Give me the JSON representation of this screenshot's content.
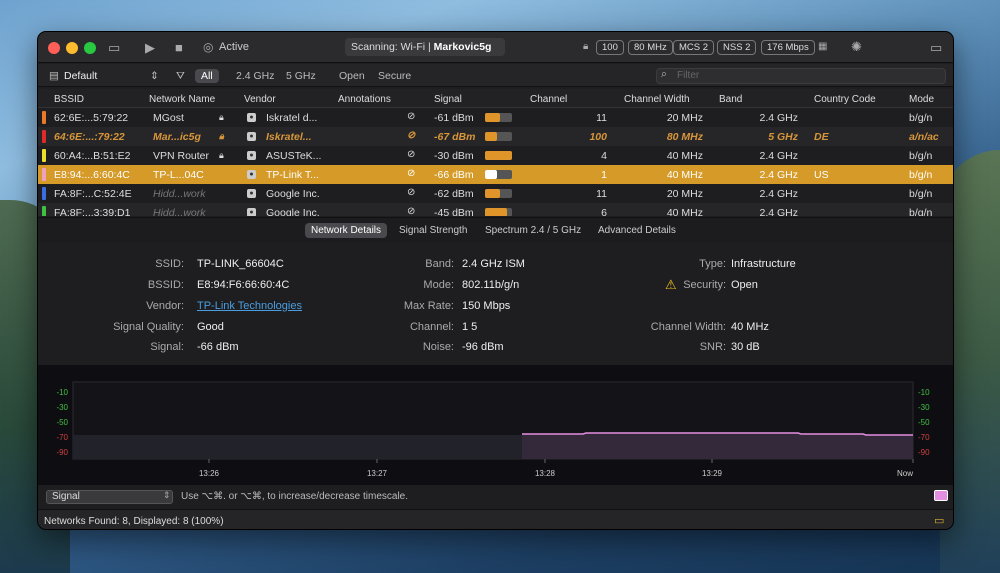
{
  "titlebar": {
    "active_label": "Active",
    "scan_prefix": "Scanning: Wi-Fi  |  ",
    "scan_network": "Markovic5g",
    "pills": [
      "100",
      "80 MHz",
      "MCS 2",
      "NSS 2",
      "176 Mbps"
    ]
  },
  "toolbar": {
    "profile": "Default",
    "filters": [
      "All",
      "2.4 GHz",
      "5 GHz",
      "Open",
      "Secure"
    ],
    "search_placeholder": "Filter"
  },
  "columns": [
    "BSSID",
    "Network Name",
    "Vendor",
    "Annotations",
    "Signal",
    "Channel",
    "Channel Width",
    "Band",
    "Country Code",
    "Mode"
  ],
  "rows": [
    {
      "tag": "#e8782a",
      "bssid": "62:6E:...5:79:22",
      "name": "MGost",
      "lock": true,
      "vendor": "Iskratel d...",
      "signal": "-61 dBm",
      "level": 0.55,
      "channel": "11",
      "width": "20 MHz",
      "band": "2.4 GHz",
      "country": "",
      "mode": "b/g/n"
    },
    {
      "tag": "#e02a2a",
      "bssid": "64:6E:...:79:22",
      "name": "Mar...ic5g",
      "lock": true,
      "vendor": "Iskratel...",
      "signal": "-67 dBm",
      "level": 0.45,
      "channel": "100",
      "width": "80 MHz",
      "band": "5 GHz",
      "country": "DE",
      "mode": "a/n/ac"
    },
    {
      "tag": "#e8e02a",
      "bssid": "60:A4:...B:51:E2",
      "name": "VPN Router",
      "lock": true,
      "vendor": "ASUSTeK...",
      "signal": "-30 dBm",
      "level": 1.0,
      "channel": "4",
      "width": "40 MHz",
      "band": "2.4 GHz",
      "country": "",
      "mode": "b/g/n"
    },
    {
      "tag": "#f0a0c0",
      "bssid": "E8:94:...6:60:4C",
      "name": "TP-L...04C",
      "lock": false,
      "vendor": "TP-Link T...",
      "signal": "-66 dBm",
      "level": 0.45,
      "channel": "1",
      "width": "40 MHz",
      "band": "2.4 GHz",
      "country": "US",
      "mode": "b/g/n"
    },
    {
      "tag": "#3a6ee0",
      "bssid": "FA:8F:...C:52:4E",
      "name": "Hidd...work",
      "lock": false,
      "vendor": "Google Inc.",
      "signal": "-62 dBm",
      "level": 0.55,
      "channel": "11",
      "width": "20 MHz",
      "band": "2.4 GHz",
      "country": "",
      "mode": "b/g/n"
    },
    {
      "tag": "#40c040",
      "bssid": "FA:8F:...3:39:D1",
      "name": "Hidd...work",
      "lock": false,
      "vendor": "Google Inc.",
      "signal": "-45 dBm",
      "level": 0.8,
      "channel": "6",
      "width": "40 MHz",
      "band": "2.4 GHz",
      "country": "",
      "mode": "b/g/n"
    }
  ],
  "tabs": [
    "Network Details",
    "Signal Strength",
    "Spectrum 2.4 / 5 GHz",
    "Advanced Details"
  ],
  "details": {
    "ssid_l": "SSID:",
    "ssid": "TP-LINK_66604C",
    "bssid_l": "BSSID:",
    "bssid": "E8:94:F6:66:60:4C",
    "vendor_l": "Vendor:",
    "vendor": "TP-Link Technologies",
    "quality_l": "Signal Quality:",
    "quality": "Good",
    "signal_l": "Signal:",
    "signal": "-66 dBm",
    "band_l": "Band:",
    "band": "2.4 GHz ISM",
    "mode_l": "Mode:",
    "mode": "802.11b/g/n",
    "rate_l": "Max Rate:",
    "rate": "150 Mbps",
    "channel_l": "Channel:",
    "channel": "1 5",
    "noise_l": "Noise:",
    "noise": "-96 dBm",
    "type_l": "Type:",
    "type": "Infrastructure",
    "security_l": "Security:",
    "security": "Open",
    "cwidth_l": "Channel Width:",
    "cwidth": "40 MHz",
    "snr_l": "SNR:",
    "snr": "30 dB"
  },
  "graph": {
    "y_ticks": [
      "-10",
      "-30",
      "-50",
      "-70",
      "-90"
    ],
    "x_ticks": [
      "13:26",
      "13:27",
      "13:28",
      "13:29",
      "Now"
    ],
    "line_color": "#e38ee0"
  },
  "footer": {
    "select": "Signal",
    "hint": "Use ⌥⌘. or ⌥⌘, to increase/decrease timescale."
  },
  "status": "Networks Found: 8, Displayed: 8 (100%)"
}
